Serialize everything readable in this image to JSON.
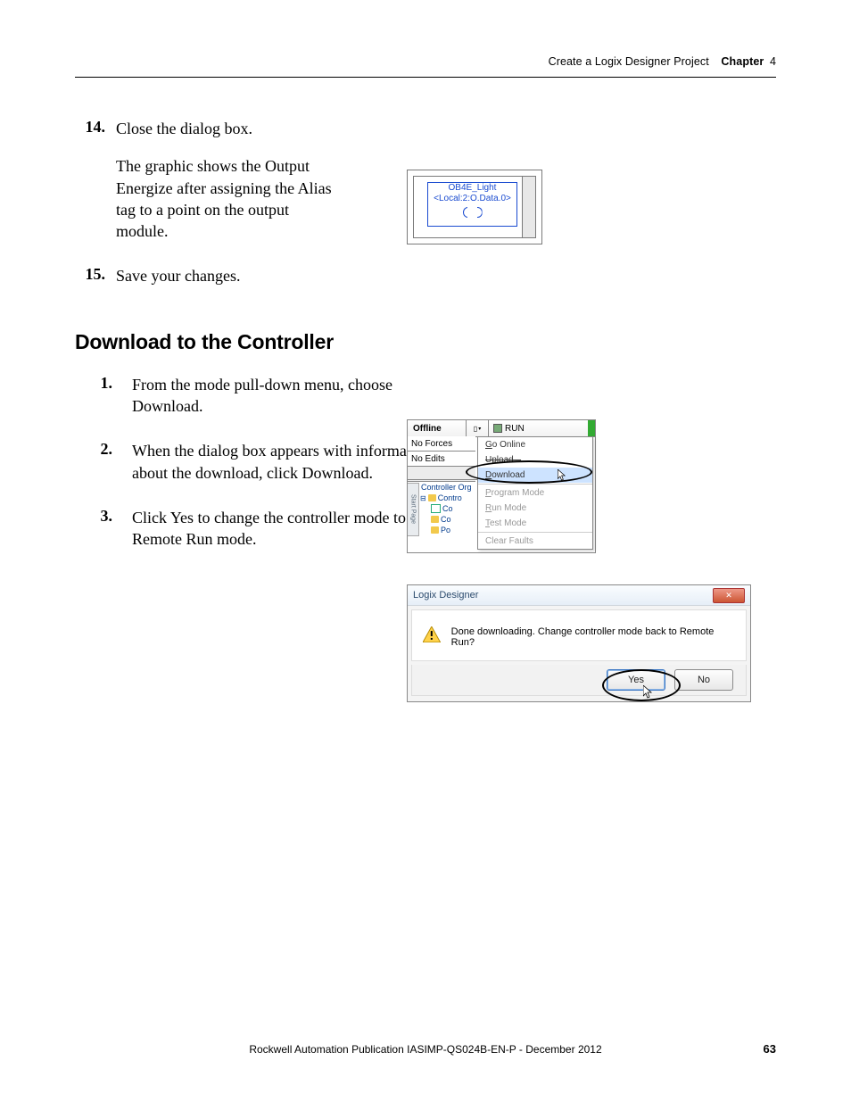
{
  "header": {
    "breadcrumb": "Create a Logix Designer Project",
    "chapter_label": "Chapter",
    "chapter_num": "4"
  },
  "steps_a": [
    {
      "num": "14.",
      "text": "Close the dialog box.",
      "sub": "The graphic shows the Output Energize after assigning the Alias tag to a point on the output module."
    },
    {
      "num": "15.",
      "text": "Save your changes."
    }
  ],
  "section_heading": "Download to the Controller",
  "steps_b": [
    {
      "num": "1.",
      "text": "From the mode pull-down menu, choose Download."
    },
    {
      "num": "2.",
      "text": "When the dialog box appears with information about the download, click Download."
    },
    {
      "num": "3.",
      "text": "Click Yes to change the controller mode to Remote Run mode."
    }
  ],
  "fig1": {
    "line1": "OB4E_Light",
    "line2": "<Local:2:O.Data.0>"
  },
  "fig2": {
    "offline": "Offline",
    "run": "RUN",
    "no_forces": "No Forces",
    "no_edits": "No Edits",
    "tree_root": "Controller Org",
    "tree_items": [
      "Contro",
      "Co",
      "Co",
      "Po"
    ],
    "tab": "Start Page",
    "menu": {
      "go_online": "Go Online",
      "upload": "Upload...",
      "download": "Download",
      "program": "Program Mode",
      "run": "Run Mode",
      "test": "Test Mode",
      "clear": "Clear Faults"
    }
  },
  "fig3": {
    "title": "Logix Designer",
    "msg": "Done downloading. Change controller mode back to Remote Run?",
    "yes": "Yes",
    "no": "No",
    "close": "✕"
  },
  "footer": "Rockwell Automation Publication IASIMP-QS024B-EN-P - December 2012",
  "page_num": "63"
}
